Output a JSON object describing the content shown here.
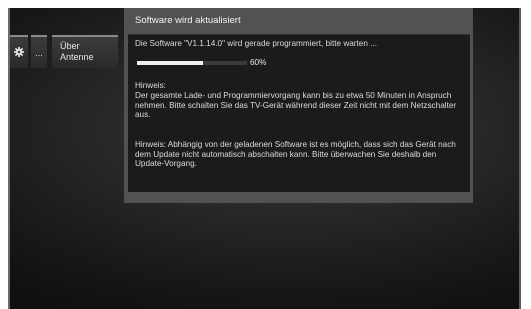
{
  "sidebar": {
    "settings_icon": "gear-icon",
    "more_label": "...",
    "info_tile": {
      "line1": "Über",
      "line2": "Antenne"
    }
  },
  "dialog": {
    "title": "Software wird aktualisiert",
    "status": "Die Software \"V1.1.14.0\" wird gerade programmiert, bitte warten ...",
    "progress": {
      "percent": 60,
      "label": "60%"
    },
    "note1_heading": "Hinweis:",
    "note1_text": "Der gesamte Lade- und Programmiervorgang kann bis zu etwa 50 Minuten in Anspruch nehmen. Bitte schalten Sie das TV-Gerät während dieser Zeit nicht mit dem Netzschalter aus.",
    "note2_text": "Hinweis: Abhängig von der geladenen Software ist es möglich, dass sich das Gerät nach dem Update nicht automatisch abschalten kann. Bitte überwachen Sie deshalb den Update-Vorgang."
  },
  "colors": {
    "dialog_frame": "#525252",
    "dialog_body": "#1b1b1b",
    "progress_fill": "#f0f0f0"
  }
}
